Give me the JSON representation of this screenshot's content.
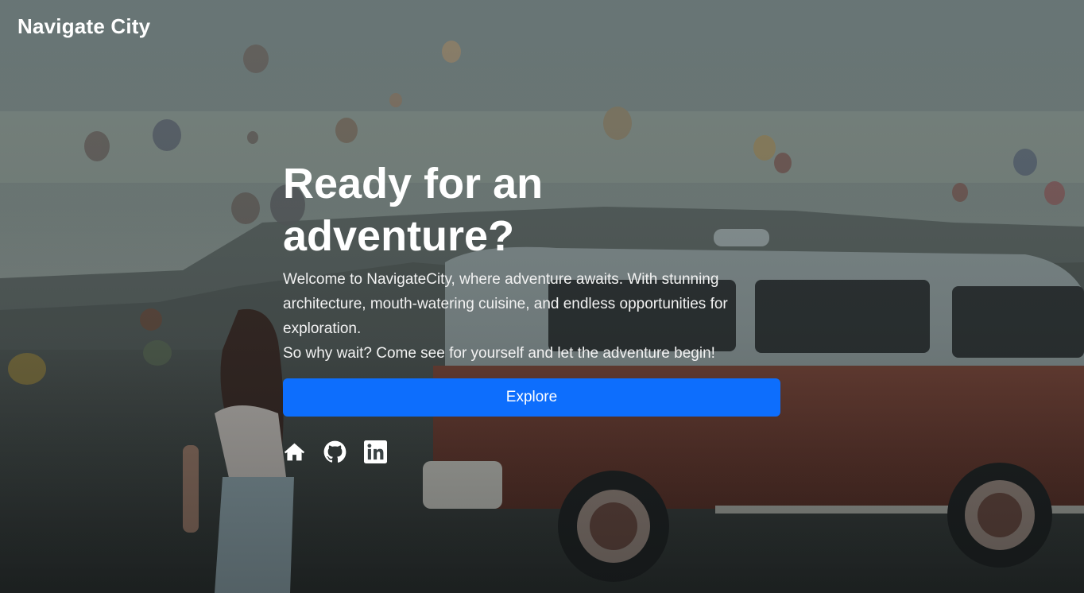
{
  "brand": {
    "title": "Navigate City"
  },
  "hero": {
    "title": "Ready for an adventure?",
    "paragraph_1": "Welcome to NavigateCity, where adventure awaits. With stunning architecture, mouth-watering cuisine, and endless opportunities for exploration.",
    "paragraph_2": "So why wait? Come see for yourself and let the adventure begin!",
    "cta_label": "Explore"
  },
  "social_links": [
    {
      "icon": "home-icon"
    },
    {
      "icon": "github-icon"
    },
    {
      "icon": "linkedin-icon"
    }
  ],
  "colors": {
    "accent": "#0d6efd",
    "text": "#ffffff"
  }
}
